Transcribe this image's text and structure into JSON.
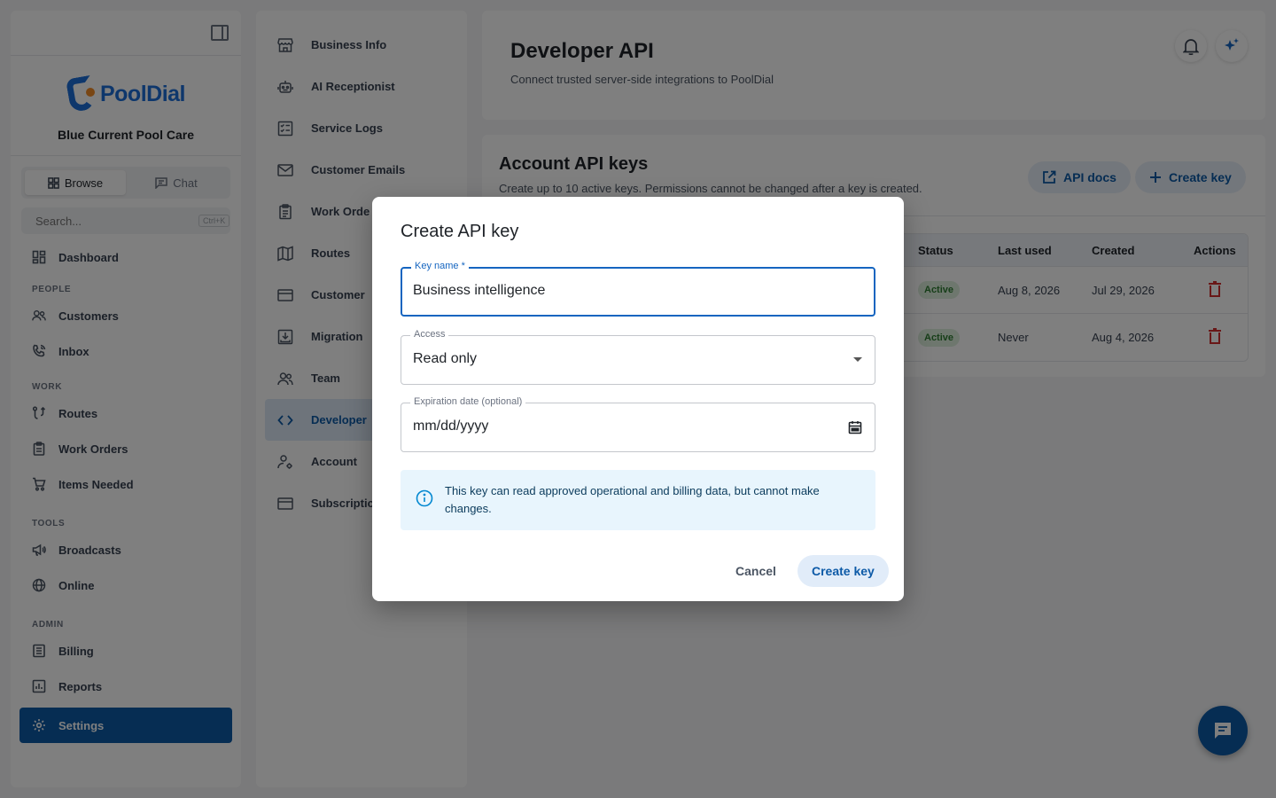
{
  "sidebar": {
    "brand": "PoolDial",
    "business_name": "Blue Current Pool Care",
    "modes": {
      "browse": "Browse",
      "chat": "Chat"
    },
    "search": {
      "placeholder": "Search...",
      "shortcut": "Ctrl+K"
    },
    "dashboard": "Dashboard",
    "sections": {
      "people": "PEOPLE",
      "work": "WORK",
      "tools": "TOOLS",
      "admin": "ADMIN"
    },
    "people_items": [
      "Customers",
      "Inbox"
    ],
    "work_items": [
      "Routes",
      "Work Orders",
      "Items Needed"
    ],
    "tools_items": [
      "Broadcasts",
      "Online"
    ],
    "admin_items": [
      "Billing",
      "Reports"
    ],
    "settings": "Settings"
  },
  "submenu": {
    "items": [
      "Business Info",
      "AI Receptionist",
      "Service Logs",
      "Customer Emails",
      "Work Orders",
      "Routes",
      "Customer Portal",
      "Migration",
      "Team",
      "Developer API",
      "Account",
      "Subscription"
    ],
    "visible": [
      "Business Info",
      "AI Receptionist",
      "Service Logs",
      "Customer Emails",
      "Work Orde",
      "Routes",
      "Customer",
      "Migration",
      "Team",
      "Developer",
      "Account",
      "Subscriptic"
    ]
  },
  "header": {
    "title": "Developer API",
    "subtitle": "Connect trusted server-side integrations to PoolDial"
  },
  "keys": {
    "title": "Account API keys",
    "subtitle": "Create up to 10 active keys. Permissions cannot be changed after a key is created.",
    "docs_label": "API docs",
    "create_label": "Create key",
    "columns": {
      "status": "Status",
      "last_used": "Last used",
      "created": "Created",
      "actions": "Actions"
    },
    "rows": [
      {
        "status": "Active",
        "last_used": "Aug 8, 2026",
        "created": "Jul 29, 2026"
      },
      {
        "status": "Active",
        "last_used": "Never",
        "created": "Aug 4, 2026"
      }
    ]
  },
  "dialog": {
    "title": "Create API key",
    "key_name_label": "Key name *",
    "key_name_value": "Business intelligence",
    "access_label": "Access",
    "access_value": "Read only",
    "expiration_label": "Expiration date (optional)",
    "expiration_placeholder": "mm/dd/yyyy",
    "info_text": "This key can read approved operational and billing data, but cannot make changes.",
    "cancel_label": "Cancel",
    "create_label": "Create key"
  },
  "colors": {
    "primary": "#0d5aa7",
    "badge_bg": "#dcefdc",
    "badge_text": "#2e7d32",
    "danger": "#d32f2f",
    "info_bg": "#e8f5fd"
  }
}
